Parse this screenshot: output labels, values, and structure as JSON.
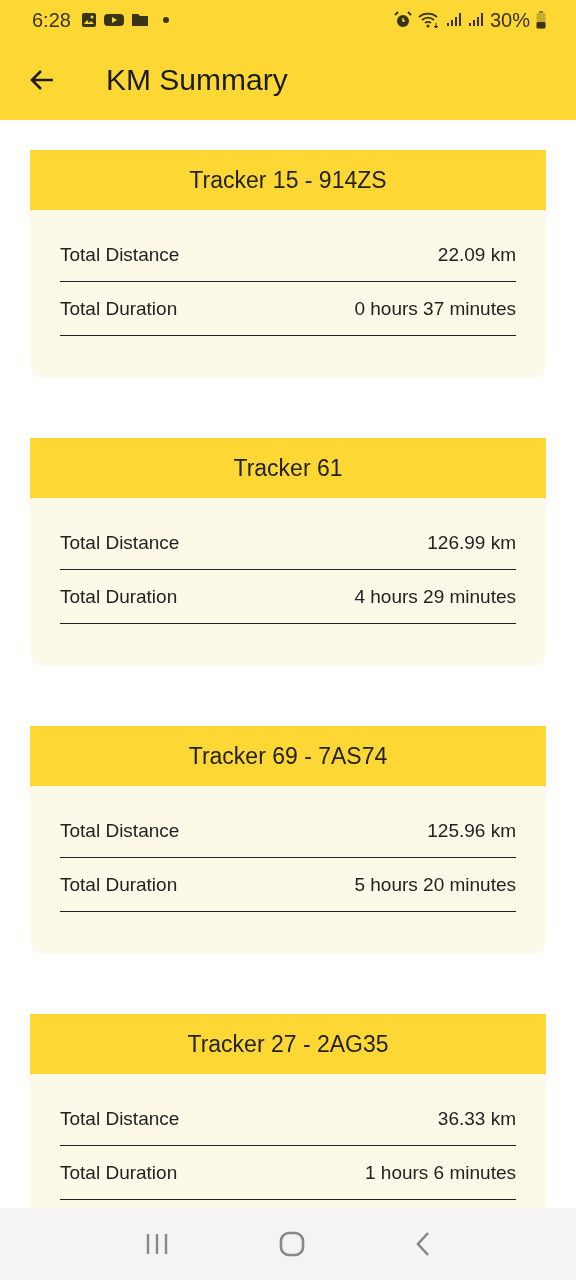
{
  "status_bar": {
    "time": "6:28",
    "battery": "30%"
  },
  "app_bar": {
    "title": "KM Summary"
  },
  "trackers": [
    {
      "title": "Tracker 15 - 914ZS",
      "rows": [
        {
          "label": "Total Distance",
          "value": "22.09 km"
        },
        {
          "label": "Total Duration",
          "value": "0 hours 37 minutes"
        }
      ]
    },
    {
      "title": "Tracker 61",
      "rows": [
        {
          "label": "Total Distance",
          "value": "126.99 km"
        },
        {
          "label": "Total Duration",
          "value": "4 hours 29 minutes"
        }
      ]
    },
    {
      "title": "Tracker 69 - 7AS74",
      "rows": [
        {
          "label": "Total Distance",
          "value": "125.96 km"
        },
        {
          "label": "Total Duration",
          "value": "5 hours 20 minutes"
        }
      ]
    },
    {
      "title": "Tracker 27 - 2AG35",
      "rows": [
        {
          "label": "Total Distance",
          "value": "36.33 km"
        },
        {
          "label": "Total Duration",
          "value": "1 hours 6 minutes"
        }
      ]
    }
  ]
}
